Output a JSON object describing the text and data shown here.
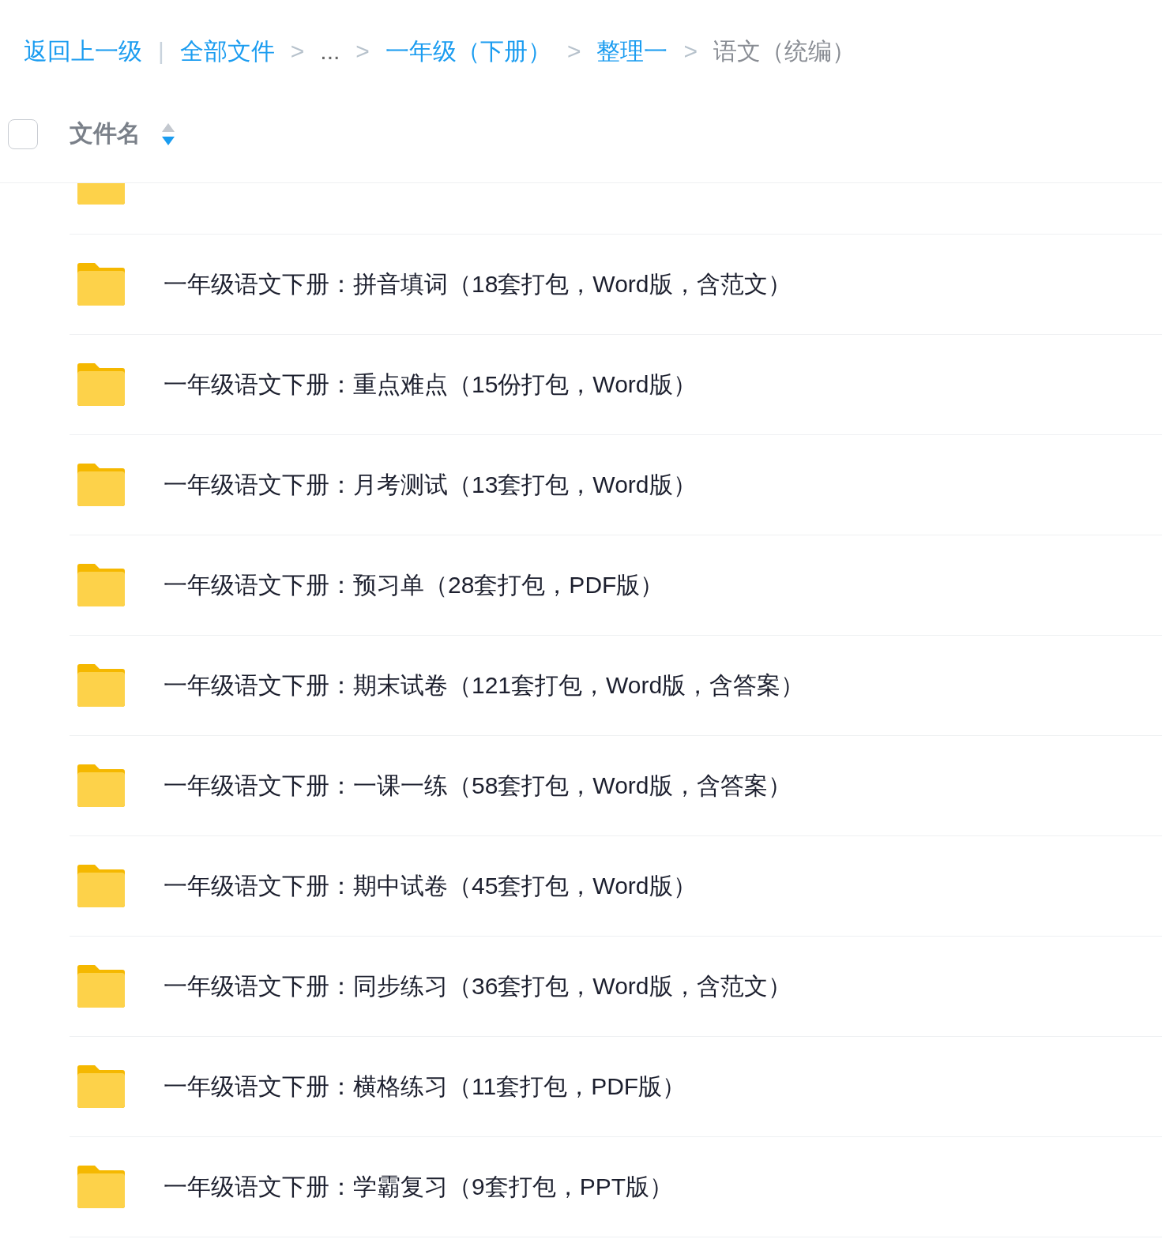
{
  "breadcrumb": [
    {
      "kind": "link",
      "label": "返回上一级"
    },
    {
      "kind": "divider",
      "label": "|"
    },
    {
      "kind": "link",
      "label": "全部文件"
    },
    {
      "kind": "separator",
      "label": ">"
    },
    {
      "kind": "ellipsis",
      "label": "..."
    },
    {
      "kind": "separator",
      "label": ">"
    },
    {
      "kind": "link",
      "label": "一年级（下册）"
    },
    {
      "kind": "separator",
      "label": ">"
    },
    {
      "kind": "link",
      "label": "整理一"
    },
    {
      "kind": "separator",
      "label": ">"
    },
    {
      "kind": "current",
      "label": "语文（统编）"
    }
  ],
  "header": {
    "checked": false,
    "column": "文件名",
    "sort_descending": true
  },
  "list": {
    "clipped_row_above": true,
    "files": [
      {
        "name": "一年级语文下册：拼音填词（18套打包，Word版，含范文）"
      },
      {
        "name": "一年级语文下册：重点难点（15份打包，Word版）"
      },
      {
        "name": "一年级语文下册：月考测试（13套打包，Word版）"
      },
      {
        "name": "一年级语文下册：预习单（28套打包，PDF版）"
      },
      {
        "name": "一年级语文下册：期末试卷（121套打包，Word版，含答案）"
      },
      {
        "name": "一年级语文下册：一课一练（58套打包，Word版，含答案）"
      },
      {
        "name": "一年级语文下册：期中试卷（45套打包，Word版）"
      },
      {
        "name": "一年级语文下册：同步练习（36套打包，Word版，含范文）"
      },
      {
        "name": "一年级语文下册：横格练习（11套打包，PDF版）"
      },
      {
        "name": "一年级语文下册：学霸复习（9套打包，PPT版）"
      }
    ]
  }
}
